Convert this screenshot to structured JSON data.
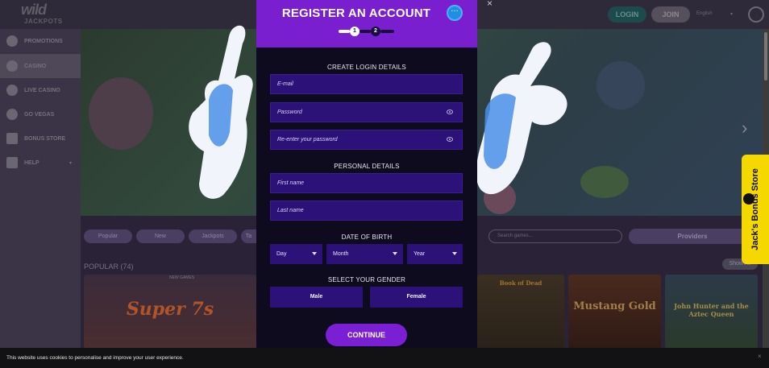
{
  "site": {
    "logo_top": "wild",
    "logo_bottom": "JACKPOTS",
    "login_label": "LOGIN",
    "join_label": "JOIN",
    "language": "English",
    "close_symbol": "×"
  },
  "sidebar": {
    "items": [
      {
        "label": "PROMOTIONS",
        "icon": "percent-icon"
      },
      {
        "label": "CASINO",
        "icon": "casino-icon"
      },
      {
        "label": "LIVE CASINO",
        "icon": "live-icon"
      },
      {
        "label": "GO VEGAS",
        "icon": "vegas-icon"
      },
      {
        "label": "BONUS STORE",
        "icon": "cart-icon"
      },
      {
        "label": "HELP",
        "icon": "help-icon"
      }
    ]
  },
  "lobby": {
    "filters": [
      "Popular",
      "New",
      "Jackpots",
      "Ta"
    ],
    "search_placeholder": "Search games...",
    "providers_label": "Providers",
    "section_title": "POPULAR (74)",
    "show_all": "Show All",
    "new_games_tag": "NEW GAMES",
    "games": [
      "Super 7s",
      "Book of Dead",
      "Mustang Gold",
      "John Hunter and the Aztec Queen"
    ]
  },
  "bonus_tab": {
    "label": "Jack's Bonus Store"
  },
  "cookie": {
    "text": "This website uses cookies to personalise and improve your user experience.",
    "close": "×"
  },
  "modal": {
    "title": "REGISTER AN ACCOUNT",
    "steps": [
      "1",
      "2"
    ],
    "login_section": "CREATE LOGIN DETAILS",
    "email_placeholder": "E-mail",
    "password_placeholder": "Password",
    "reenter_placeholder": "Re-enter your password",
    "personal_section": "PERSONAL DETAILS",
    "first_name_placeholder": "First name",
    "last_name_placeholder": "Last name",
    "dob_section": "DATE OF BIRTH",
    "day_label": "Day",
    "month_label": "Month",
    "year_label": "Year",
    "gender_section": "SELECT YOUR GENDER",
    "male_label": "Male",
    "female_label": "Female",
    "continue_label": "CONTINUE"
  },
  "colors": {
    "modal_header": "#7a1fd0",
    "field_bg": "#2b1178",
    "modal_bg": "#0e0b1e",
    "continue_btn": "#7b1fd4",
    "bonus_tab": "#f5d800"
  }
}
